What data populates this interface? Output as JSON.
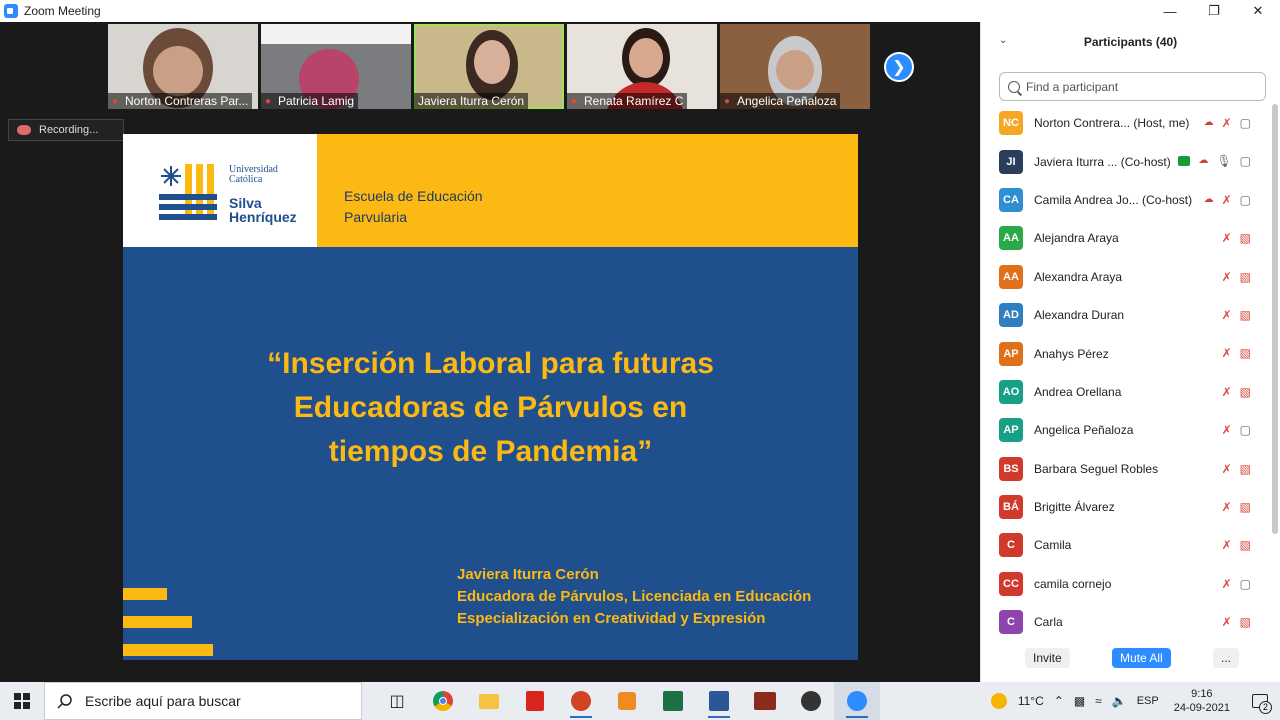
{
  "window": {
    "title": "Zoom Meeting"
  },
  "thumbnails": [
    {
      "name": "Norton Contreras Par..."
    },
    {
      "name": "Patricia Lamig"
    },
    {
      "name": "Javiera Iturra Cerón"
    },
    {
      "name": "Renata Ramírez C"
    },
    {
      "name": "Angelica Peñaloza"
    }
  ],
  "recording": {
    "label": "Recording..."
  },
  "slide": {
    "logo_small_line1": "Universidad",
    "logo_small_line2": "Católica",
    "logo_big_line1": "Silva",
    "logo_big_line2": "Henríquez",
    "school_line1": "Escuela de Educación",
    "school_line2": "Parvularia",
    "title_line1": "“Inserción Laboral para futuras",
    "title_line2": "Educadoras de Párvulos en",
    "title_line3": "tiempos de Pandemia”",
    "presenter_line1": "Javiera Iturra Cerón",
    "presenter_line2": "Educadora de Párvulos, Licenciada en Educación",
    "presenter_line3": "Especialización en Creatividad y Expresión"
  },
  "participants": {
    "title": "Participants (40)",
    "search_placeholder": "Find a participant",
    "list": [
      {
        "initials": "NC",
        "color": "#f5a623",
        "name": "Norton Contrera... (Host, me)"
      },
      {
        "initials": "JI",
        "color": "#2b3e5c",
        "name": "Javiera Iturra ... (Co-host)"
      },
      {
        "initials": "CA",
        "color": "#2f8fd0",
        "name": "Camila Andrea Jo... (Co-host)"
      },
      {
        "initials": "AA",
        "color": "#2aa84a",
        "name": "Alejandra Araya"
      },
      {
        "initials": "AA",
        "color": "#e0701a",
        "name": "Alexandra Araya"
      },
      {
        "initials": "AD",
        "color": "#2f7fc0",
        "name": "Alexandra Duran"
      },
      {
        "initials": "AP",
        "color": "#e0701a",
        "name": "Anahys Pérez"
      },
      {
        "initials": "AO",
        "color": "#16a085",
        "name": "Andrea Orellana"
      },
      {
        "initials": "AP",
        "color": "#16a085",
        "name": "Angelica Peñaloza"
      },
      {
        "initials": "BS",
        "color": "#d0392b",
        "name": "Barbara Seguel Robles"
      },
      {
        "initials": "BÁ",
        "color": "#d0392b",
        "name": "Brigitte Álvarez"
      },
      {
        "initials": "C",
        "color": "#d0392b",
        "name": "Camila"
      },
      {
        "initials": "CC",
        "color": "#d0392b",
        "name": "camila cornejo"
      },
      {
        "initials": "C",
        "color": "#8e44ad",
        "name": "Carla"
      }
    ],
    "invite_label": "Invite",
    "mute_all_label": "Mute All",
    "more_label": "..."
  },
  "taskbar": {
    "search_placeholder": "Escribe aquí para buscar",
    "weather": "11°C",
    "language": "ESP",
    "time": "9:16",
    "date": "24-09-2021",
    "notifications": "2"
  }
}
